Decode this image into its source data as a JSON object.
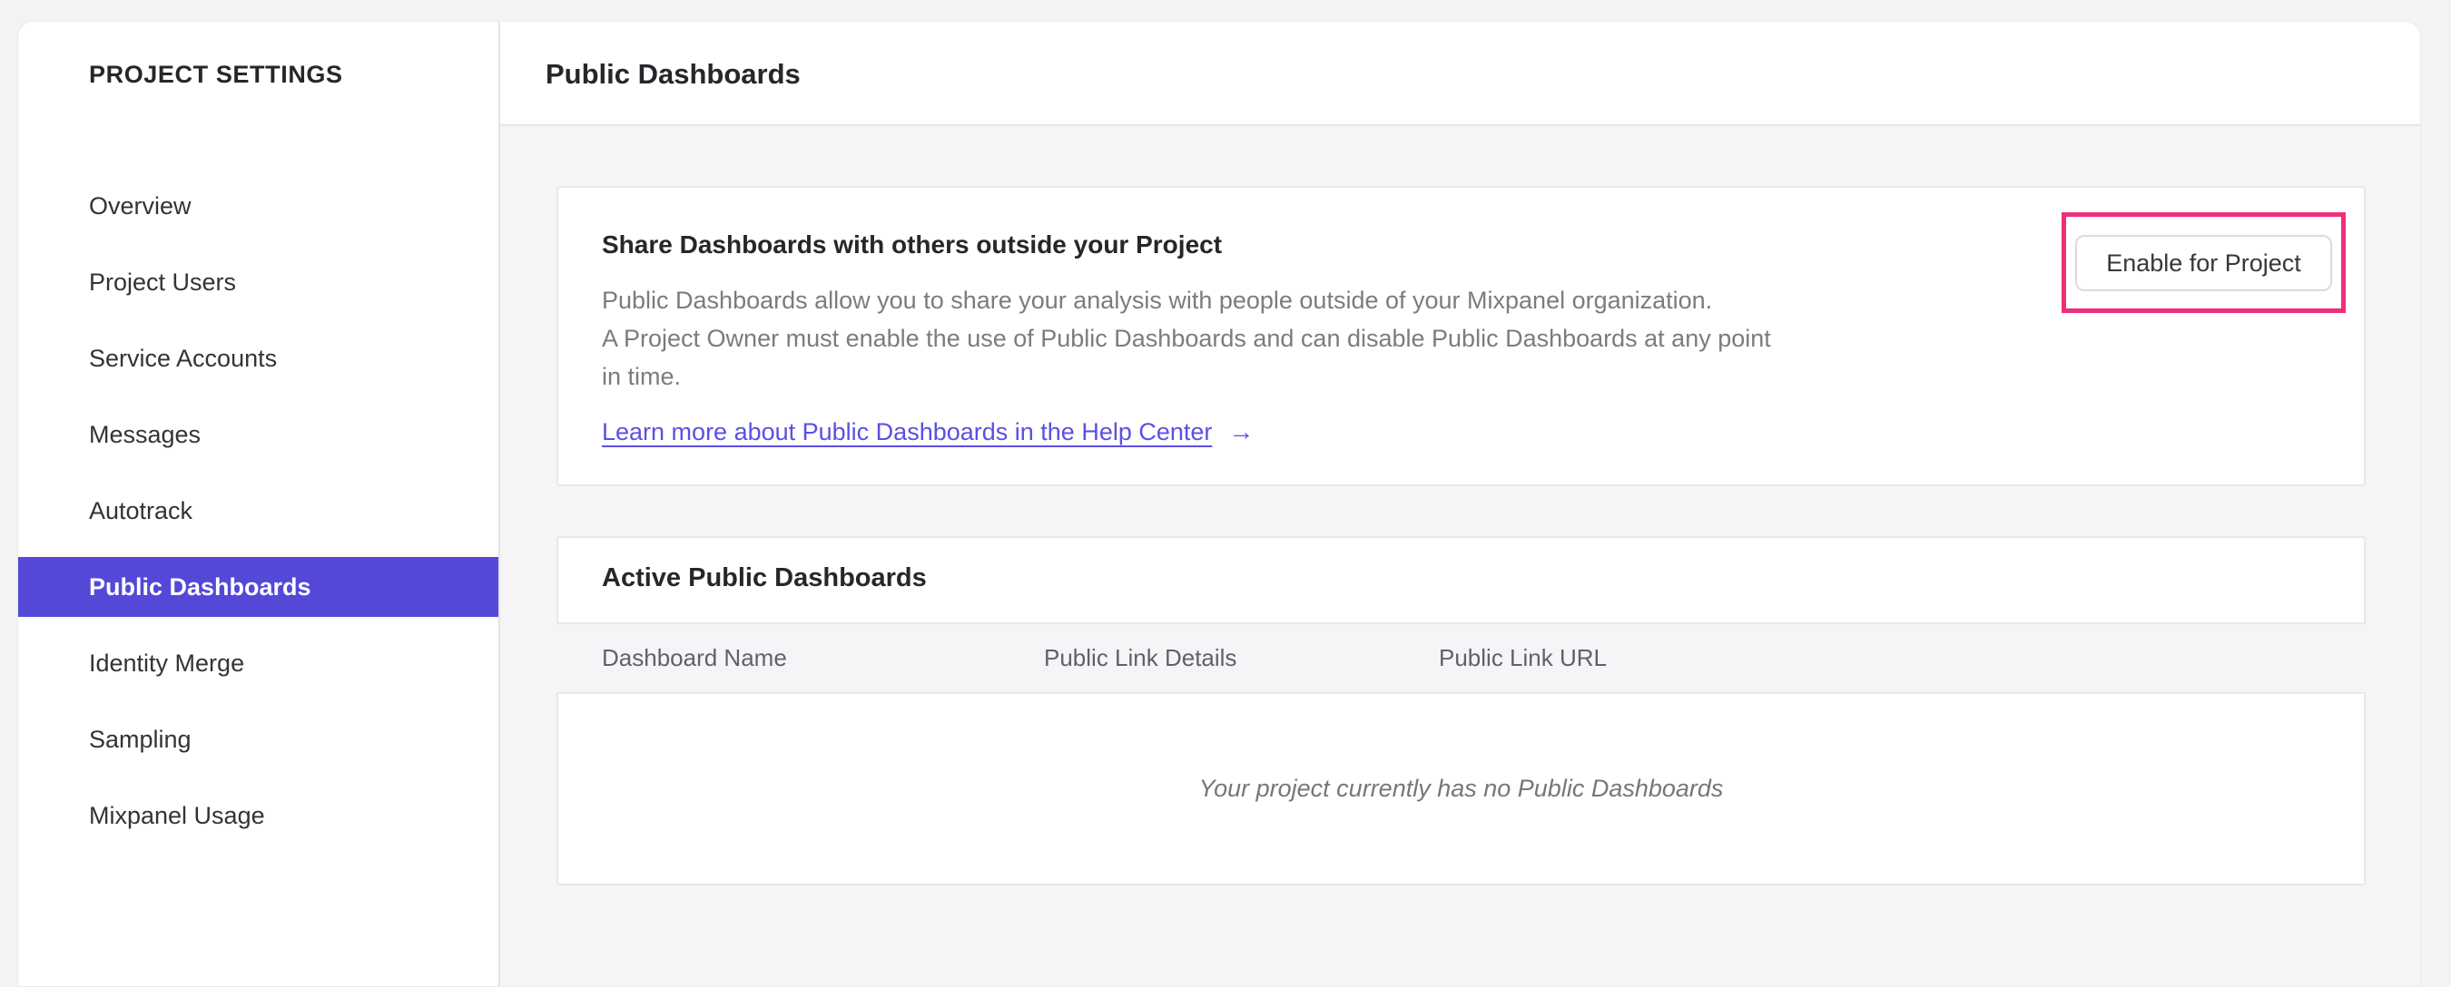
{
  "colors": {
    "page_bg": "#f3f3f4",
    "content_bg": "#f6f5f6",
    "panel_bg": "#ffffff",
    "border": "#e8e7e9",
    "accent_purple": "#5348d8",
    "link_purple": "#5a50e4",
    "annotation_pink": "#ee2f7b",
    "text_dark": "#26262b",
    "text_body_gray": "#7c7b81",
    "table_header_gray": "#616167"
  },
  "sidebar": {
    "title": "PROJECT SETTINGS",
    "items": [
      {
        "label": "Overview",
        "active": false
      },
      {
        "label": "Project Users",
        "active": false
      },
      {
        "label": "Service Accounts",
        "active": false
      },
      {
        "label": "Messages",
        "active": false
      },
      {
        "label": "Autotrack",
        "active": false
      },
      {
        "label": "Public Dashboards",
        "active": true
      },
      {
        "label": "Identity Merge",
        "active": false
      },
      {
        "label": "Sampling",
        "active": false
      },
      {
        "label": "Mixpanel Usage",
        "active": false
      }
    ]
  },
  "header": {
    "title": "Public Dashboards"
  },
  "share_card": {
    "heading": "Share Dashboards with others outside your Project",
    "body_lines": [
      "Public Dashboards allow you to share your analysis with people outside of your Mixpanel organization.",
      "A Project Owner must enable the use of Public Dashboards and can disable Public Dashboards at any point",
      "in time."
    ],
    "link_label": "Learn more about Public Dashboards in the Help Center",
    "arrow_icon": "→",
    "button_label": "Enable for Project"
  },
  "dashboards_card": {
    "title": "Active Public Dashboards",
    "columns": [
      "Dashboard Name",
      "Public Link Details",
      "Public Link URL"
    ],
    "rows": [],
    "empty_message": "Your project currently has no Public Dashboards"
  }
}
